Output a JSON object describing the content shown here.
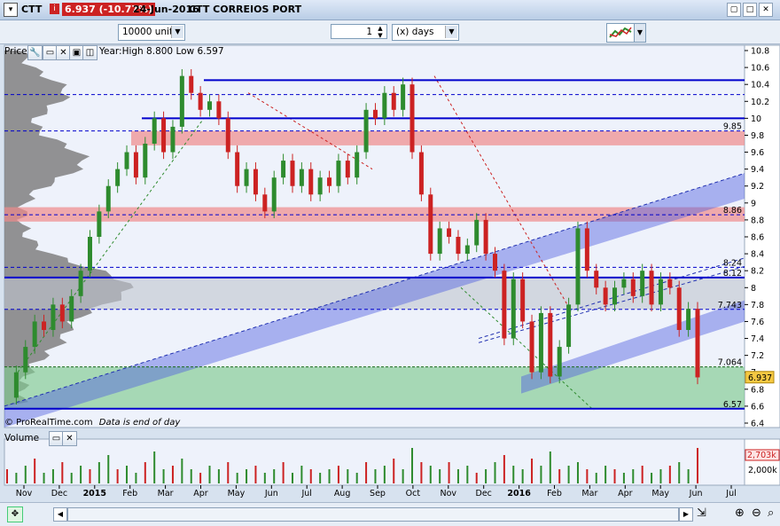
{
  "titlebar": {
    "symbol": "CTT",
    "price_badge": "6.937 (-10.77%)",
    "date": "24-Jun-2016",
    "name": "CTT CORREIOS PORT"
  },
  "toolbar": {
    "units": "10000 units",
    "period_value": "1",
    "period_unit": "(x) days"
  },
  "price_panel": {
    "label": "Price",
    "info": "Year:High 8.800 Low 6.597",
    "watermark": "© ProRealTime.com",
    "note": "Data is end of day"
  },
  "volume_panel": {
    "label": "Volume",
    "last_value": "2,703k",
    "tick": "2,000k"
  },
  "chart_data": {
    "type": "candlestick",
    "y_ticks": [
      "10.8",
      "10.6",
      "10.4",
      "10.2",
      "10",
      "9.8",
      "9.6",
      "9.4",
      "9.2",
      "9",
      "8.8",
      "8.6",
      "8.4",
      "8.2",
      "8",
      "7.8",
      "7.6",
      "7.4",
      "7.2",
      "7",
      "6.8",
      "6.6",
      "6.4"
    ],
    "ylim": [
      6.4,
      10.8
    ],
    "x_labels": [
      "Nov",
      "Dec",
      "2015",
      "Feb",
      "Mar",
      "Apr",
      "May",
      "Jun",
      "Jul",
      "Aug",
      "Sep",
      "Oct",
      "Nov",
      "Dec",
      "2016",
      "Feb",
      "Mar",
      "Apr",
      "May",
      "Jun",
      "Jul"
    ],
    "level_labels": [
      {
        "text": "9.85",
        "y": 9.85
      },
      {
        "text": "8.86",
        "y": 8.86
      },
      {
        "text": "8.24",
        "y": 8.24
      },
      {
        "text": "8.12",
        "y": 8.12
      },
      {
        "text": "7.743",
        "y": 7.743
      },
      {
        "text": "7.064",
        "y": 7.064
      },
      {
        "text": "6.57",
        "y": 6.57
      }
    ],
    "last_price": {
      "text": "6.937",
      "y": 6.937
    },
    "price_path": [
      [
        0,
        6.7
      ],
      [
        1,
        7.0
      ],
      [
        2,
        7.3
      ],
      [
        3,
        7.6
      ],
      [
        4,
        7.5
      ],
      [
        5,
        7.8
      ],
      [
        6,
        7.6
      ],
      [
        7,
        7.9
      ],
      [
        8,
        8.2
      ],
      [
        9,
        8.6
      ],
      [
        10,
        8.9
      ],
      [
        11,
        9.2
      ],
      [
        12,
        9.4
      ],
      [
        13,
        9.6
      ],
      [
        14,
        9.3
      ],
      [
        15,
        9.7
      ],
      [
        16,
        10.0
      ],
      [
        17,
        9.6
      ],
      [
        18,
        9.9
      ],
      [
        19,
        10.5
      ],
      [
        20,
        10.3
      ],
      [
        21,
        10.1
      ],
      [
        22,
        10.2
      ],
      [
        23,
        10.0
      ],
      [
        24,
        9.6
      ],
      [
        25,
        9.2
      ],
      [
        26,
        9.4
      ],
      [
        27,
        9.1
      ],
      [
        28,
        8.9
      ],
      [
        29,
        9.3
      ],
      [
        30,
        9.5
      ],
      [
        31,
        9.2
      ],
      [
        32,
        9.4
      ],
      [
        33,
        9.1
      ],
      [
        34,
        9.3
      ],
      [
        35,
        9.2
      ],
      [
        36,
        9.5
      ],
      [
        37,
        9.3
      ],
      [
        38,
        9.6
      ],
      [
        39,
        10.1
      ],
      [
        40,
        10.0
      ],
      [
        41,
        10.3
      ],
      [
        42,
        10.1
      ],
      [
        43,
        10.4
      ],
      [
        44,
        9.6
      ],
      [
        45,
        9.1
      ],
      [
        46,
        8.4
      ],
      [
        47,
        8.7
      ],
      [
        48,
        8.6
      ],
      [
        49,
        8.4
      ],
      [
        50,
        8.5
      ],
      [
        51,
        8.8
      ],
      [
        52,
        8.4
      ],
      [
        53,
        8.2
      ],
      [
        54,
        7.4
      ],
      [
        55,
        8.1
      ],
      [
        56,
        7.6
      ],
      [
        57,
        7.0
      ],
      [
        58,
        7.7
      ],
      [
        59,
        6.95
      ],
      [
        60,
        7.3
      ],
      [
        61,
        7.8
      ],
      [
        62,
        8.7
      ],
      [
        63,
        8.2
      ],
      [
        64,
        8.0
      ],
      [
        65,
        7.8
      ],
      [
        66,
        8.0
      ],
      [
        67,
        8.1
      ],
      [
        68,
        7.9
      ],
      [
        69,
        8.2
      ],
      [
        70,
        7.8
      ],
      [
        71,
        8.1
      ],
      [
        72,
        8.0
      ],
      [
        73,
        7.5
      ],
      [
        74,
        7.75
      ],
      [
        75,
        6.94
      ]
    ],
    "volume_values": [
      0.4,
      0.3,
      0.5,
      0.7,
      0.3,
      0.4,
      0.6,
      0.3,
      0.5,
      0.4,
      0.6,
      0.8,
      0.4,
      0.5,
      0.3,
      0.6,
      0.9,
      0.4,
      0.5,
      0.7,
      0.4,
      0.3,
      0.5,
      0.4,
      0.6,
      0.3,
      0.4,
      0.5,
      0.3,
      0.4,
      0.6,
      0.3,
      0.5,
      0.4,
      0.3,
      0.4,
      0.5,
      0.4,
      0.3,
      0.6,
      0.4,
      0.5,
      0.7,
      0.4,
      1.0,
      0.6,
      0.5,
      0.4,
      0.6,
      0.4,
      0.5,
      0.3,
      0.4,
      0.6,
      0.8,
      0.5,
      0.4,
      0.7,
      0.5,
      0.9,
      0.4,
      0.5,
      0.6,
      0.4,
      0.3,
      0.5,
      0.4,
      0.3,
      0.4,
      0.5,
      0.3,
      0.4,
      0.5,
      0.6,
      0.4,
      1.0
    ]
  },
  "colors": {
    "up": "#2e8b2e",
    "down": "#cc2222",
    "channel": "#4f5fe0",
    "level": "#0000cc",
    "zone_red": "#f08a8a",
    "zone_green": "#7fc98f",
    "profile": "#808080"
  },
  "icons": [
    "wrench-icon",
    "window-icon",
    "close-icon",
    "zoom-in-icon",
    "zoom-out-icon",
    "search-icon",
    "chart-type-icon"
  ]
}
